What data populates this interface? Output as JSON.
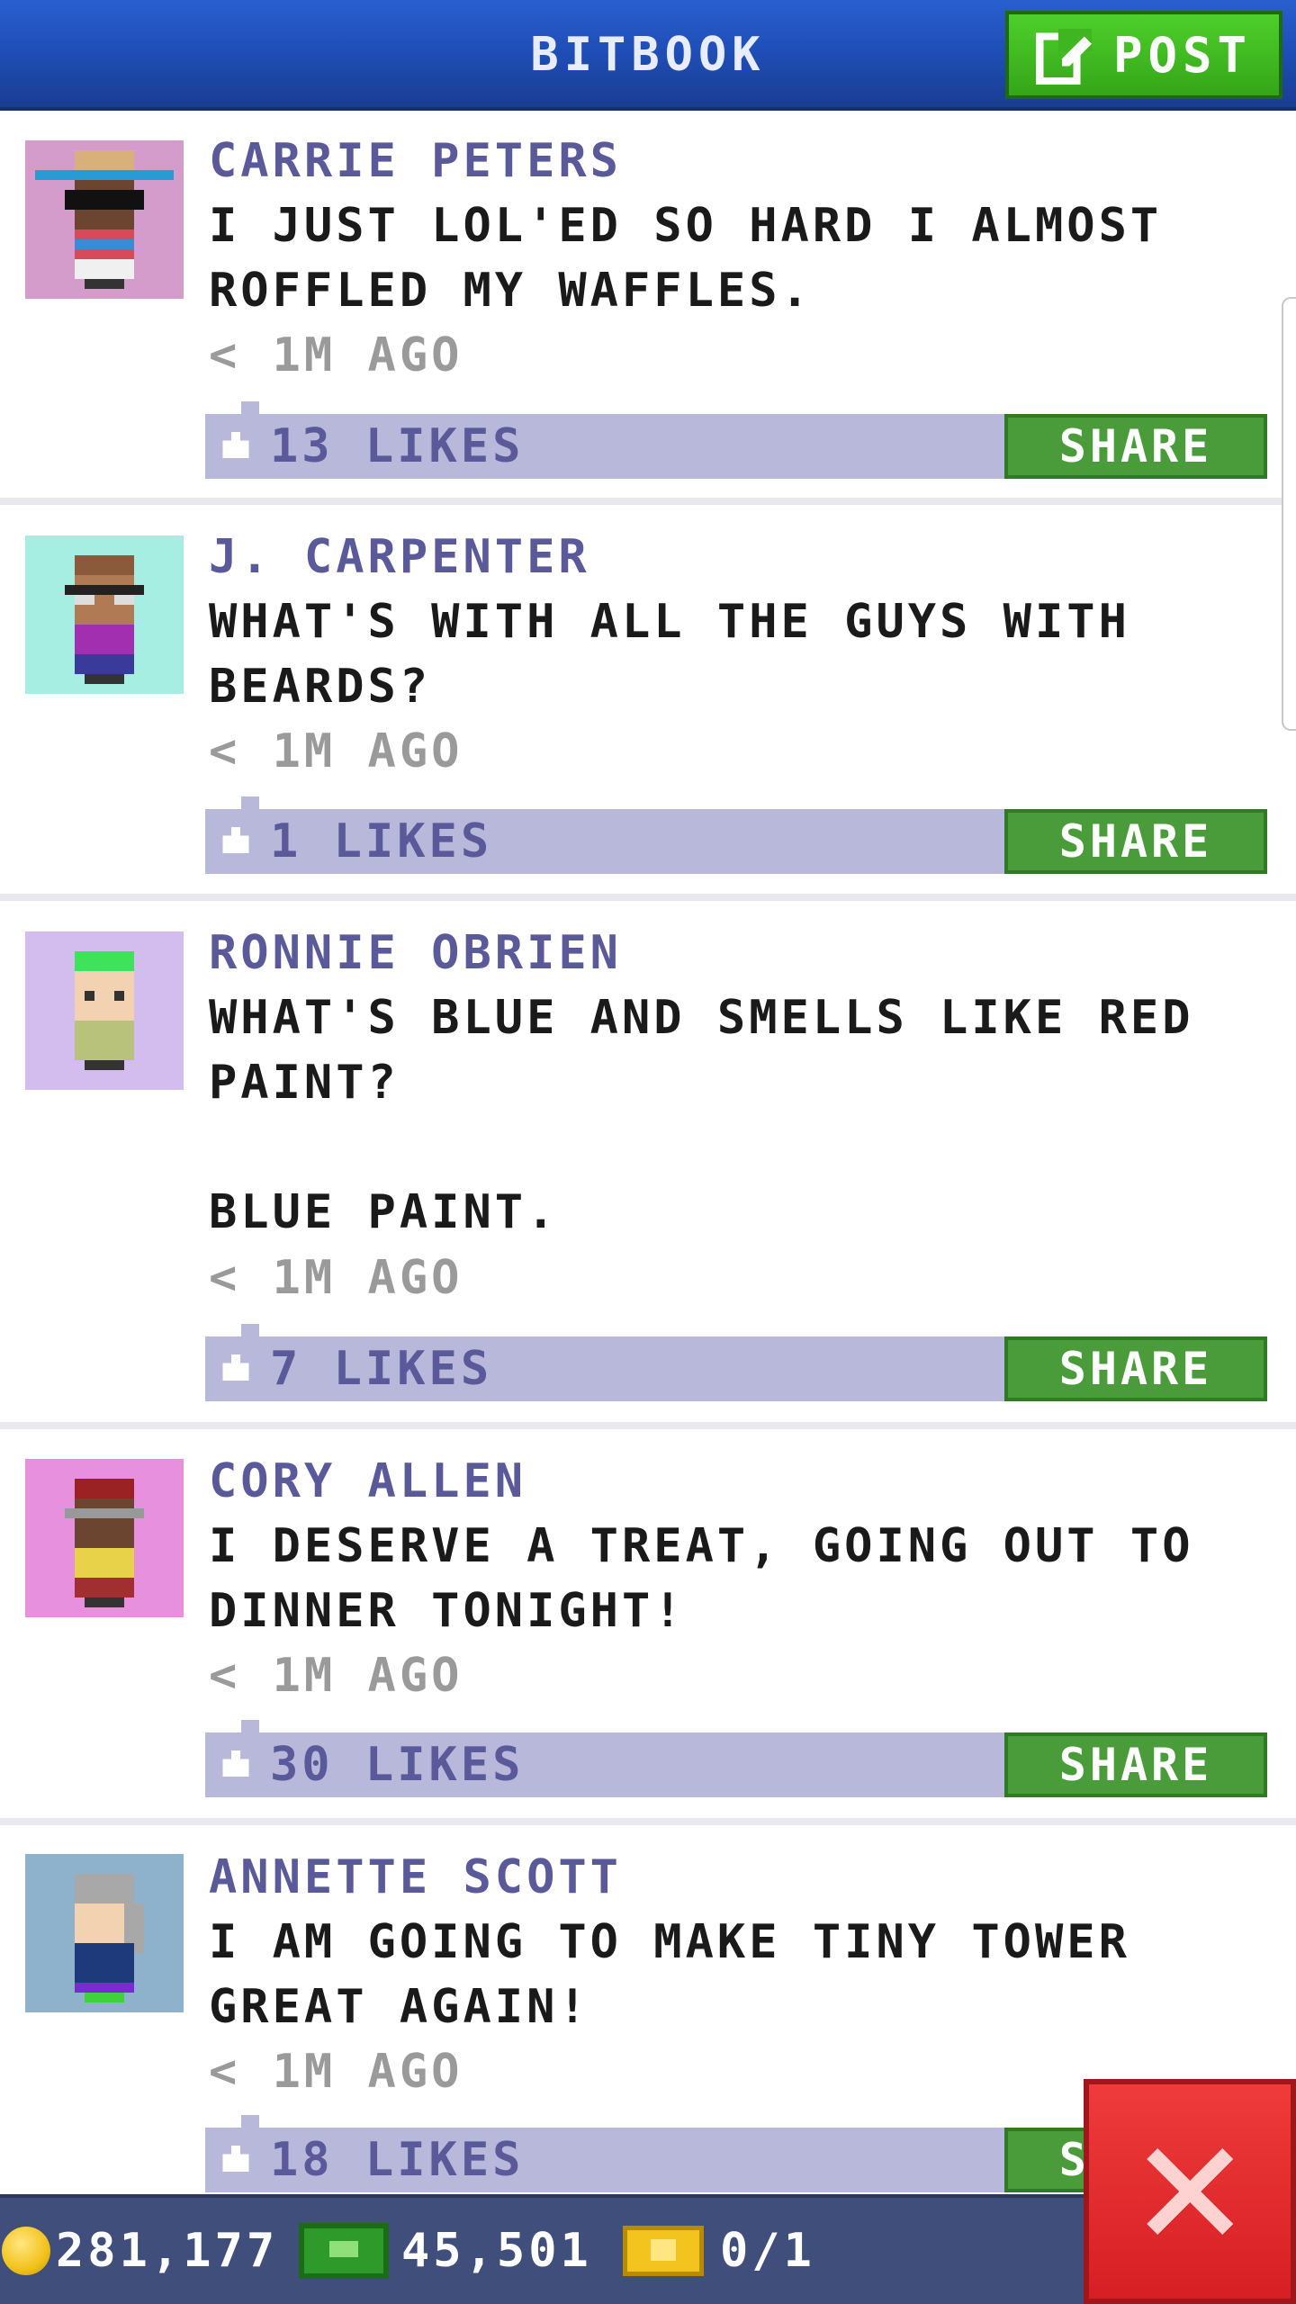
{
  "header": {
    "title": "BITBOOK",
    "post_label": "POST"
  },
  "posts": [
    {
      "author": "CARRIE PETERS",
      "message": "I JUST LOL'ED SO HARD I ALMOST\nROFFLED MY WAFFLES.",
      "time": "< 1M AGO",
      "likes": "13 LIKES",
      "share": "SHARE",
      "avatar_bg": "#d49ccb"
    },
    {
      "author": "J. CARPENTER",
      "message": "WHAT'S WITH ALL THE GUYS WITH\nBEARDS?",
      "time": "< 1M AGO",
      "likes": "1 LIKES",
      "share": "SHARE",
      "avatar_bg": "#a6ede2"
    },
    {
      "author": "RONNIE OBRIEN",
      "message": "WHAT'S BLUE AND SMELLS LIKE RED\nPAINT?\n\nBLUE PAINT.",
      "time": "< 1M AGO",
      "likes": "7 LIKES",
      "share": "SHARE",
      "avatar_bg": "#d2bdee"
    },
    {
      "author": "CORY ALLEN",
      "message": "I DESERVE A TREAT, GOING OUT TO\nDINNER TONIGHT!",
      "time": "< 1M AGO",
      "likes": "30 LIKES",
      "share": "SHARE",
      "avatar_bg": "#e790dd"
    },
    {
      "author": "ANNETTE SCOTT",
      "message": "I AM GOING TO MAKE TINY TOWER\nGREAT AGAIN!",
      "time": "< 1M AGO",
      "likes": "18 LIKES",
      "share": "SHARE",
      "avatar_bg": "#8fb2cc"
    }
  ],
  "footer": {
    "coins": "281,177",
    "bux": "45,501",
    "tickets": "0/1"
  },
  "colors": {
    "header": "#1f4fb8",
    "post_button": "#3fb51f",
    "like_bar": "#b7b8da",
    "share_button": "#4a9c3a",
    "footer": "#3f4e7a",
    "close_button": "#d61f24"
  },
  "icons": [
    "compose-icon",
    "like-icon",
    "coin-icon",
    "bux-icon",
    "ticket-icon",
    "close-icon"
  ]
}
